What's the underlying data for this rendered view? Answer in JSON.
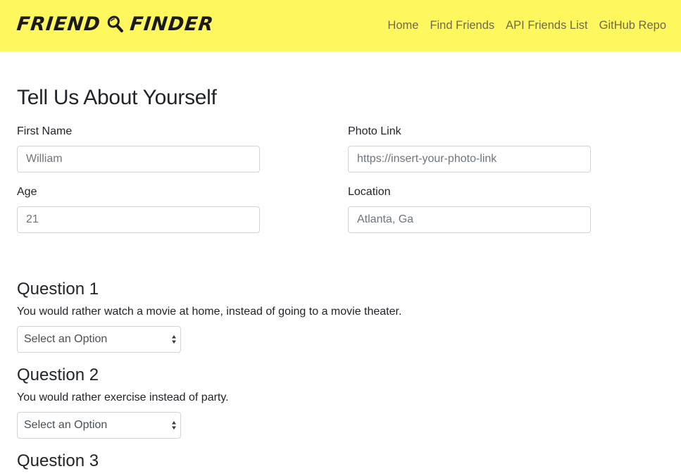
{
  "nav": {
    "brand_left": "FRIEND",
    "brand_right": "FINDER",
    "brand_icon": "magnifier-icon",
    "links": [
      "Home",
      "Find Friends",
      "API Friends List",
      "GitHub Repo"
    ],
    "bg_color": "#fff75e"
  },
  "form": {
    "title": "Tell Us About Yourself",
    "first_name": {
      "label": "First Name",
      "placeholder": "William"
    },
    "photo": {
      "label": "Photo Link",
      "placeholder": "https://insert-your-photo-link"
    },
    "age": {
      "label": "Age",
      "placeholder": "21"
    },
    "location": {
      "label": "Location",
      "placeholder": "Atlanta, Ga"
    }
  },
  "questions": [
    {
      "heading": "Question 1",
      "text": "You would rather watch a movie at home, instead of going to a movie theater.",
      "selected": "Select an Option"
    },
    {
      "heading": "Question 2",
      "text": "You would rather exercise instead of party.",
      "selected": "Select an Option"
    },
    {
      "heading": "Question 3"
    }
  ]
}
